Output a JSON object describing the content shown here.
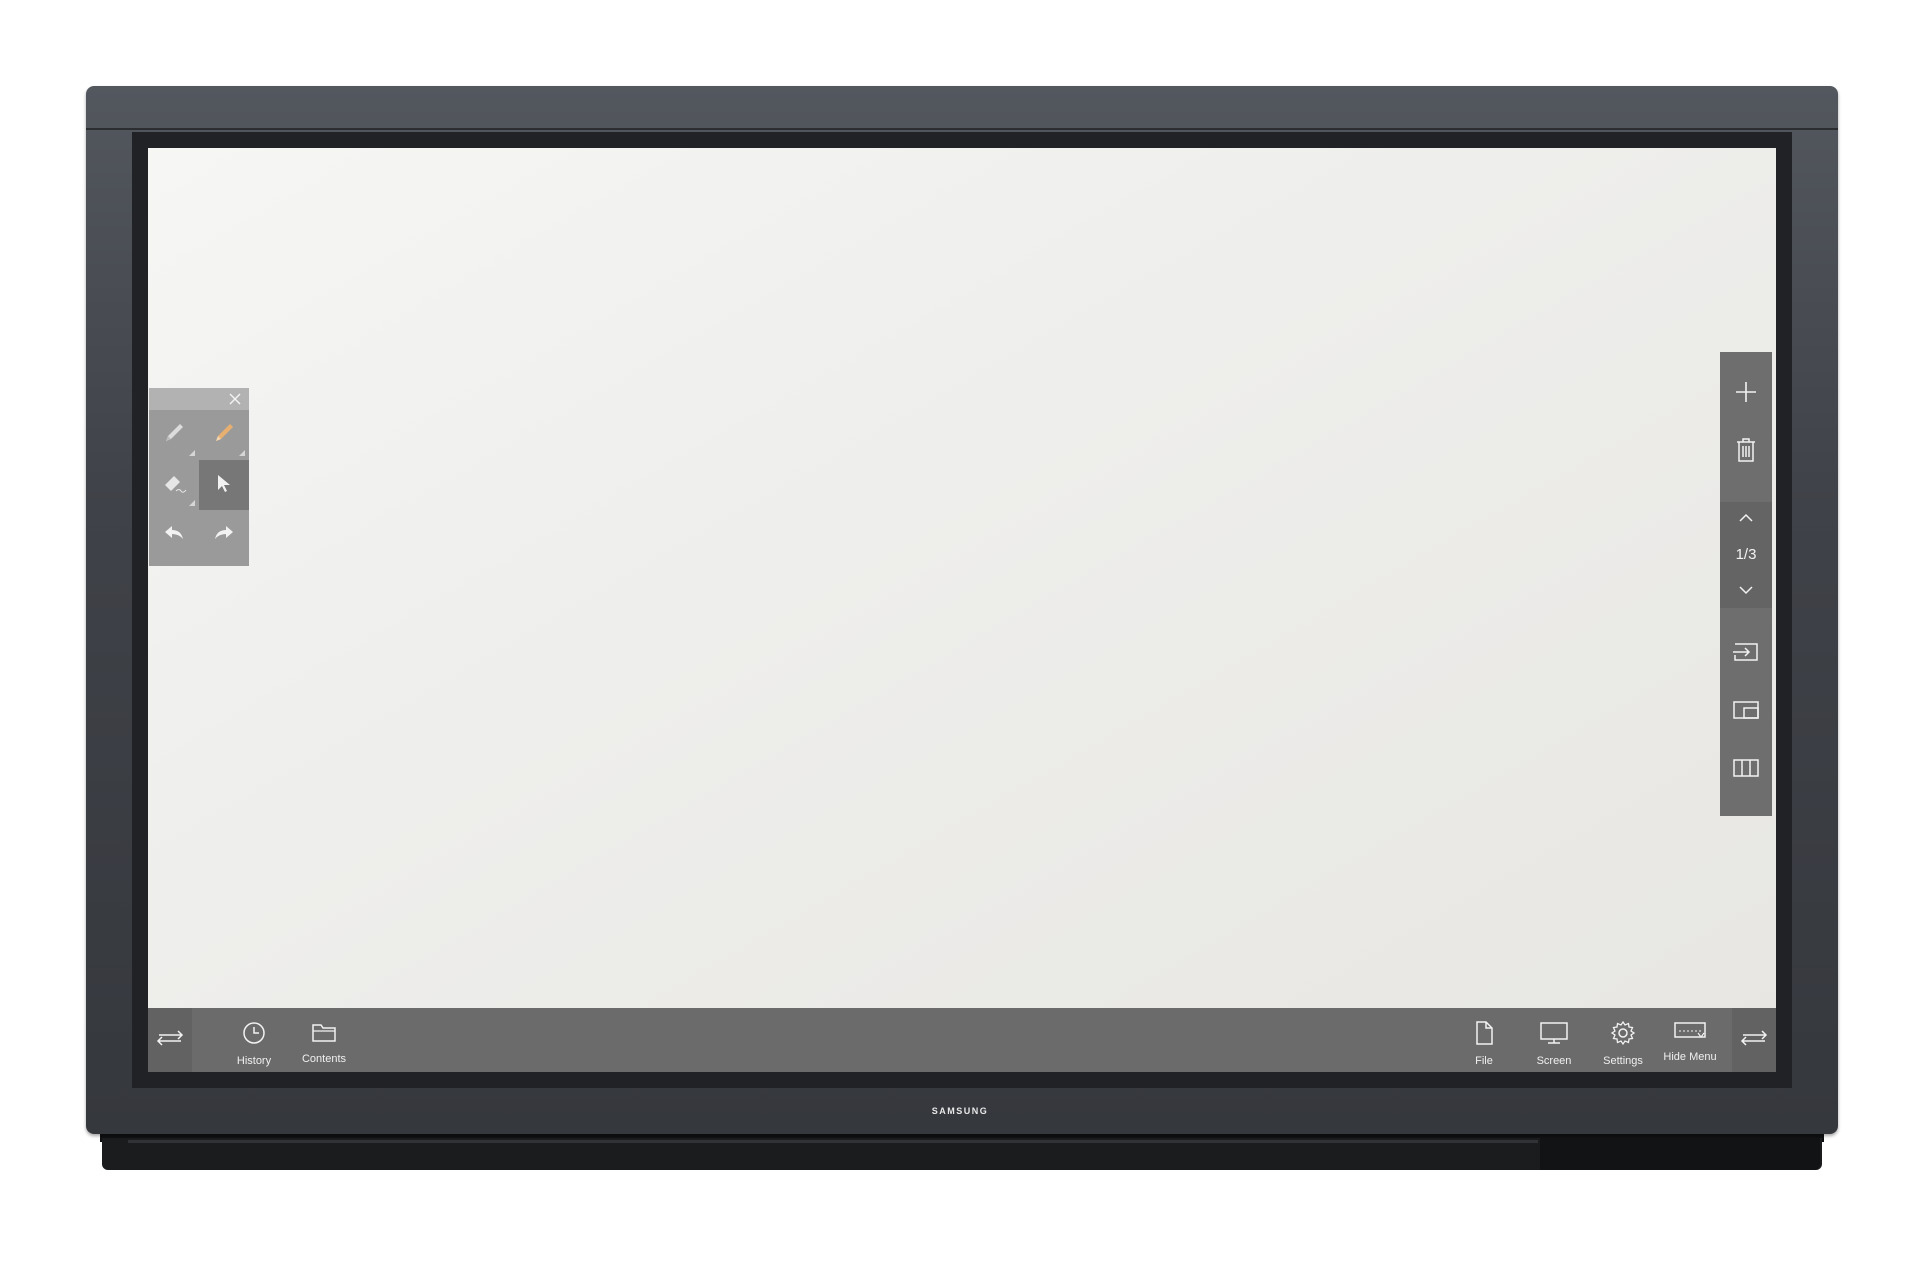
{
  "brand": "SAMSUNG",
  "toolbox": {
    "close_icon": "close-icon",
    "tools": [
      {
        "name": "pen-icon",
        "state": "inactive"
      },
      {
        "name": "highlighter-icon",
        "state": "inactive"
      },
      {
        "name": "eraser-icon",
        "state": "inactive"
      },
      {
        "name": "select-pointer-icon",
        "state": "selected"
      },
      {
        "name": "undo-icon",
        "state": "inactive"
      },
      {
        "name": "redo-icon",
        "state": "inactive"
      }
    ]
  },
  "sidebar": {
    "add_page": "plus-icon",
    "delete_page": "trash-icon",
    "page_indicator": "1/3",
    "page_up": "chevron-up-icon",
    "page_down": "chevron-down-icon",
    "input_source": "input-source-icon",
    "pip": "picture-in-picture-icon",
    "split_view": "split-view-icon"
  },
  "bottombar": {
    "left_items": [
      {
        "label": "History",
        "icon": "history-clock-icon"
      },
      {
        "label": "Contents",
        "icon": "folder-icon"
      }
    ],
    "right_items": [
      {
        "label": "File",
        "icon": "file-icon"
      },
      {
        "label": "Screen",
        "icon": "monitor-icon"
      },
      {
        "label": "Settings",
        "icon": "gear-icon"
      },
      {
        "label": "Hide Menu",
        "icon": "hide-menu-icon"
      }
    ],
    "swap_icon": "swap-arrows-icon"
  },
  "colors": {
    "bezel": "#3f4248",
    "screen": "#ecebe8",
    "menu_bar": "#6b6b6b",
    "pen_accent": "#e8b070"
  }
}
